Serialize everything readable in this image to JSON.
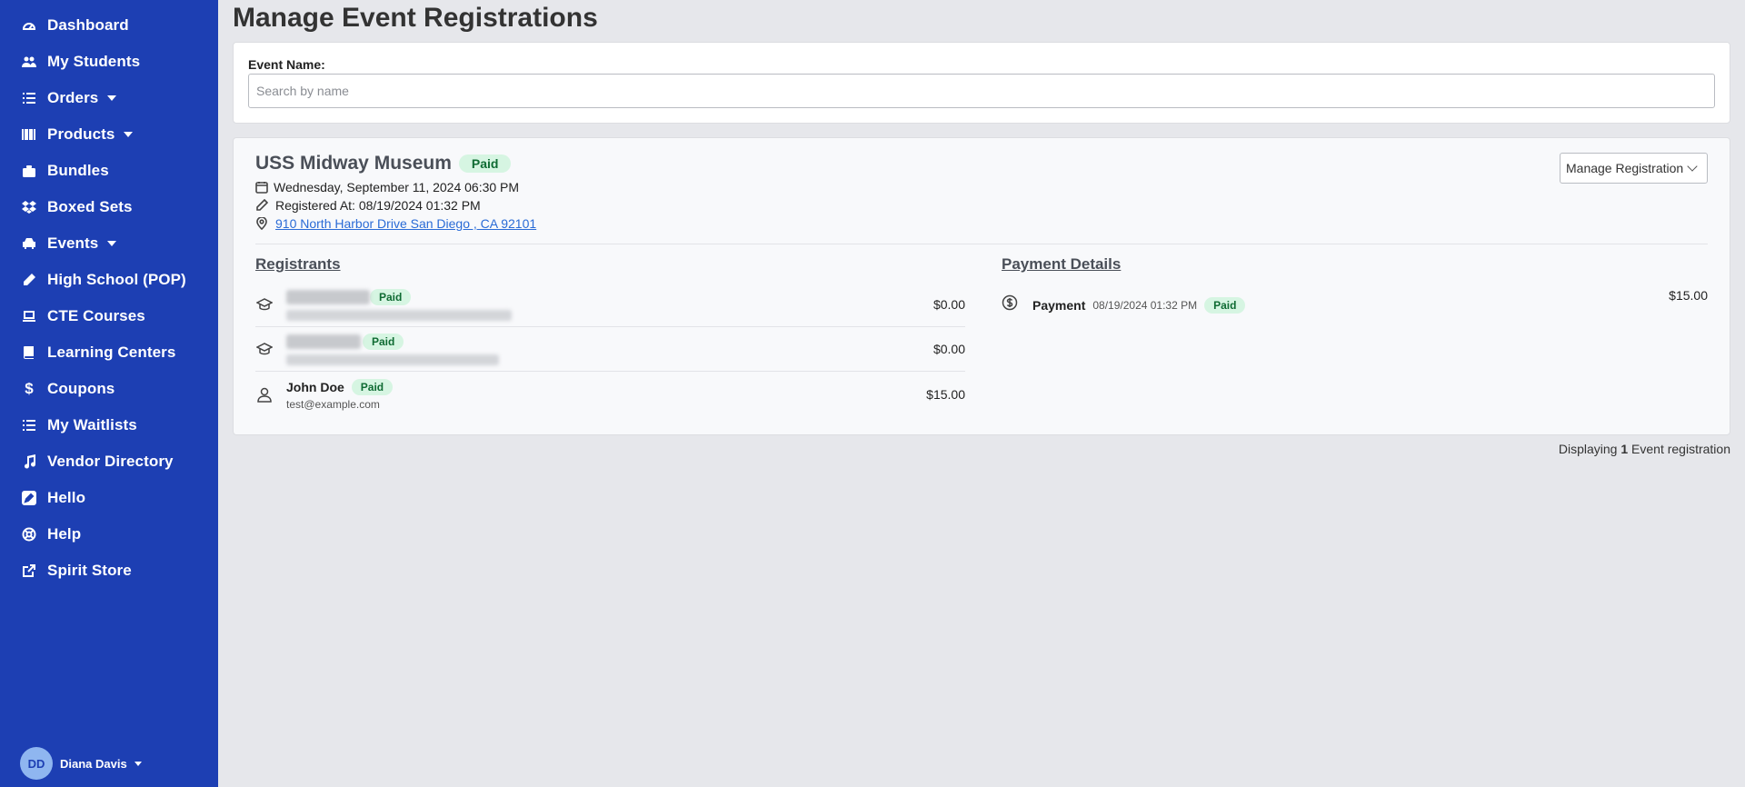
{
  "sidebar": {
    "items": [
      {
        "label": "Dashboard",
        "icon": "dashboard-icon"
      },
      {
        "label": "My Students",
        "icon": "users-icon"
      },
      {
        "label": "Orders",
        "icon": "list-icon",
        "dropdown": true
      },
      {
        "label": "Products",
        "icon": "barcode-icon",
        "dropdown": true
      },
      {
        "label": "Bundles",
        "icon": "briefcase-icon"
      },
      {
        "label": "Boxed Sets",
        "icon": "dropbox-icon"
      },
      {
        "label": "Events",
        "icon": "car-icon",
        "dropdown": true
      },
      {
        "label": "High School (POP)",
        "icon": "pencil-icon"
      },
      {
        "label": "CTE Courses",
        "icon": "laptop-icon"
      },
      {
        "label": "Learning Centers",
        "icon": "book-icon"
      },
      {
        "label": "Coupons",
        "icon": "dollar-icon"
      },
      {
        "label": "My Waitlists",
        "icon": "list-icon"
      },
      {
        "label": "Vendor Directory",
        "icon": "music-icon"
      },
      {
        "label": "Hello",
        "icon": "edit-square-icon"
      },
      {
        "label": "Help",
        "icon": "lifebuoy-icon"
      },
      {
        "label": "Spirit Store",
        "icon": "external-link-icon"
      }
    ],
    "user": {
      "initials": "DD",
      "name": "Diana Davis"
    }
  },
  "page": {
    "title": "Manage Event Registrations"
  },
  "filter": {
    "label": "Event Name:",
    "placeholder": "Search by name",
    "value": ""
  },
  "event": {
    "title": "USS Midway Museum",
    "status": "Paid",
    "datetime": "Wednesday, September 11, 2024 06:30 PM",
    "registered_at": "Registered At: 08/19/2024 01:32 PM",
    "address": "910 North Harbor Drive San Diego , CA 92101",
    "manage_label": "Manage Registration"
  },
  "registrants": {
    "title": "Registrants",
    "rows": [
      {
        "name": "",
        "email": "",
        "status": "Paid",
        "amount": "$0.00",
        "type": "student",
        "redacted": true
      },
      {
        "name": "",
        "email": "",
        "status": "Paid",
        "amount": "$0.00",
        "type": "student",
        "redacted": true
      },
      {
        "name": "John Doe",
        "email": "test@example.com",
        "status": "Paid",
        "amount": "$15.00",
        "type": "person",
        "redacted": false
      }
    ]
  },
  "payment": {
    "title": "Payment Details",
    "rows": [
      {
        "label": "Payment",
        "date": "08/19/2024 01:32 PM",
        "status": "Paid",
        "amount": "$15.00"
      }
    ]
  },
  "footer": {
    "prefix": "Displaying",
    "count": "1",
    "suffix": "Event registration"
  },
  "colors": {
    "sidebar": "#1d3fb3",
    "badge_bg": "#d6f5e2",
    "badge_text": "#0f6b33",
    "link": "#2a6bd6"
  }
}
